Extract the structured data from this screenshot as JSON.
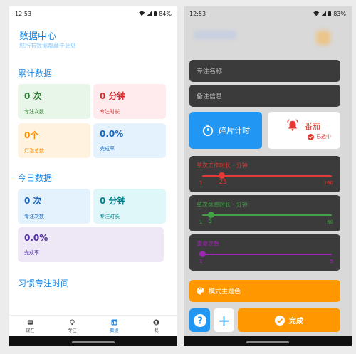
{
  "left": {
    "status": {
      "time": "12:53",
      "battery": "84%"
    },
    "title": "数据中心",
    "subtitle": "您所有数据都藏于此处",
    "cumulative": {
      "heading": "累计数据",
      "cards": [
        {
          "value": "0 次",
          "label": "专注次数",
          "fg": "#2e7d32",
          "bg": "#e8f5e9"
        },
        {
          "value": "0 分钟",
          "label": "专注时长",
          "fg": "#d32f2f",
          "bg": "#ffebee"
        },
        {
          "value": "0个",
          "label": "灯泡总数",
          "fg": "#fb8c00",
          "bg": "#fff3e0"
        },
        {
          "value": "0.0%",
          "label": "完成率",
          "fg": "#1565c0",
          "bg": "#e3f2fd"
        }
      ]
    },
    "today": {
      "heading": "今日数据",
      "cards": [
        {
          "value": "0 次",
          "label": "专注次数",
          "fg": "#1565c0",
          "bg": "#e3f2fd"
        },
        {
          "value": "0 分钟",
          "label": "专注时长",
          "fg": "#00838f",
          "bg": "#e0f7fa"
        },
        {
          "value": "0.0%",
          "label": "完成率",
          "fg": "#512da8",
          "bg": "#ede7f6"
        }
      ]
    },
    "habit_heading": "习惯专注时间",
    "nav": [
      {
        "label": "现在",
        "icon": "calendar-icon"
      },
      {
        "label": "专注",
        "icon": "bulb-icon"
      },
      {
        "label": "数据",
        "icon": "chart-icon"
      },
      {
        "label": "我",
        "icon": "person-icon"
      }
    ]
  },
  "right": {
    "status": {
      "time": "12:53",
      "battery": "83%"
    },
    "name_placeholder": "专注名称",
    "note_placeholder": "备注信息",
    "mode_fragment": "碎片计时",
    "mode_tomato": "番茄",
    "selected": "已选中",
    "sliders": [
      {
        "label": "单次工作时长 · 分钟",
        "min": "1",
        "max": "160",
        "value": 25,
        "color": "#e53935"
      },
      {
        "label": "单次休息时长 · 分钟",
        "min": "1",
        "max": "60",
        "value": 5,
        "color": "#43a047"
      },
      {
        "label": "重复次数",
        "min": "1",
        "max": "9",
        "value": 1,
        "color": "#9c27b0"
      }
    ],
    "theme_label": "模式主题色",
    "help": "?",
    "add": "+",
    "done": "完成"
  }
}
